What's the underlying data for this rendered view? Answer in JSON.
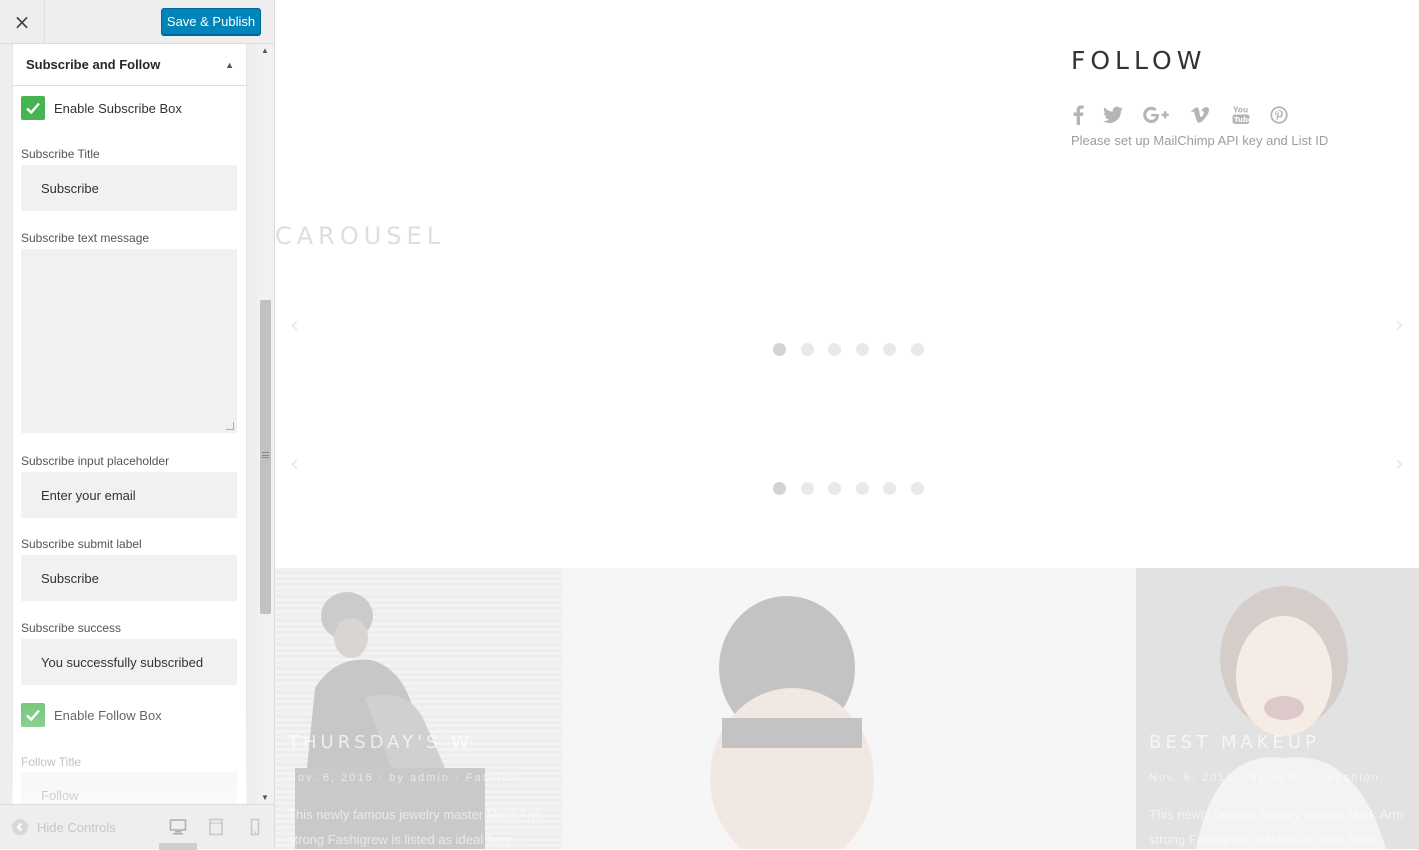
{
  "toolbar": {
    "close_label": "×",
    "publish_label": "Save & Publish"
  },
  "section": {
    "title": "Subscribe and Follow"
  },
  "controls": {
    "enable_subscribe_label": "Enable Subscribe Box",
    "subscribe_title_label": "Subscribe Title",
    "subscribe_title_value": "Subscribe",
    "subscribe_text_label": "Subscribe text message",
    "subscribe_text_value": "",
    "placeholder_label": "Subscribe input placeholder",
    "placeholder_value": "Enter your email",
    "submit_label_label": "Subscribe submit label",
    "submit_label_value": "Subscribe",
    "success_label": "Subscribe success",
    "success_value": "You successfully subscribed",
    "enable_follow_label": "Enable Follow Box",
    "follow_title_label": "Follow Title",
    "follow_title_value": "Follow"
  },
  "footer": {
    "hide_controls_label": "Hide Controls",
    "devices": [
      "desktop-icon",
      "tablet-icon",
      "mobile-icon"
    ]
  },
  "preview": {
    "follow_title": "FOLLOW",
    "social_icons": [
      "facebook-icon",
      "twitter-icon",
      "google-plus-icon",
      "vimeo-icon",
      "youtube-icon",
      "pinterest-icon"
    ],
    "mailchimp_message": "Please set up MailChimp API key and List ID",
    "carousel_title": "CAROUSEL",
    "carousel_dots_count": 6,
    "posts": [
      {
        "title": "THURSDAY'S W",
        "meta": "Nov. 6, 2016  ·  by admin  ·  Fashion",
        "excerpt": "This newly famous jewelry master Mark Arm strong Fashigrew is listed as ideal here..."
      },
      {
        "title": "",
        "meta": "",
        "excerpt": ""
      },
      {
        "title": "BEST MAKEUP",
        "meta": "Nov. 6, 2016  ·  by admin  ·  Fashion",
        "excerpt": "This newly famous jewelry master Mark Arm strong Fashigrew is listed as ideal here..."
      }
    ]
  },
  "colors": {
    "primary_button": "#0085ba",
    "checkbox": "#46b450",
    "sidebar_bg": "#eeeeee"
  }
}
